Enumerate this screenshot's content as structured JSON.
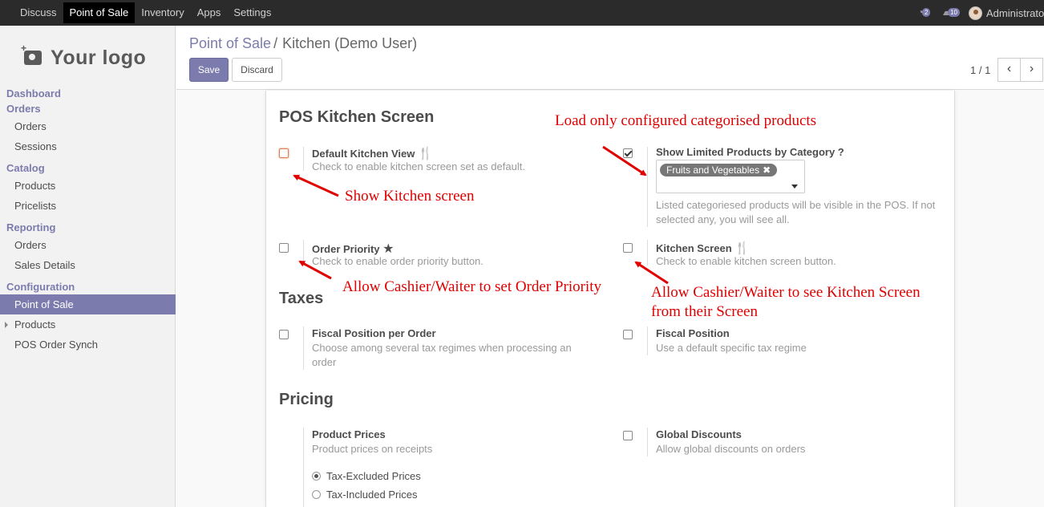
{
  "navbar": {
    "items": [
      "Discuss",
      "Point of Sale",
      "Inventory",
      "Apps",
      "Settings"
    ],
    "active": "Point of Sale",
    "activity_count": "2",
    "message_count": "10",
    "user": "Administrator"
  },
  "sidebar": {
    "logo_text": "Your logo",
    "sections": [
      {
        "label": "Dashboard",
        "items": []
      },
      {
        "label": "Orders",
        "items": [
          "Orders",
          "Sessions"
        ]
      },
      {
        "label": "Catalog",
        "items": [
          "Products",
          "Pricelists"
        ]
      },
      {
        "label": "Reporting",
        "items": [
          "Orders",
          "Sales Details"
        ]
      },
      {
        "label": "Configuration",
        "items": [
          "Point of Sale",
          "Products",
          "POS Order Synch"
        ]
      }
    ],
    "active_item": "Point of Sale"
  },
  "control_panel": {
    "breadcrumb_link": "Point of Sale",
    "breadcrumb_sep": "/",
    "breadcrumb_current": "Kitchen (Demo User)",
    "save_label": "Save",
    "discard_label": "Discard",
    "pager": "1 / 1"
  },
  "form": {
    "section_kitchen": "POS Kitchen Screen",
    "default_kitchen_view": {
      "title": "Default Kitchen View",
      "desc": "Check to enable kitchen screen set as default.",
      "checked": false
    },
    "show_limited": {
      "title": "Show Limited Products by Category ?",
      "tag": "Fruits and Vegetables",
      "desc": "Listed categoriesed products will be visible in the POS. If not selected any, you will see all.",
      "checked": true
    },
    "order_priority": {
      "title": "Order Priority",
      "desc": "Check to enable order priority button.",
      "checked": false
    },
    "kitchen_screen": {
      "title": "Kitchen Screen",
      "desc": "Check to enable kitchen screen button.",
      "checked": false
    },
    "section_taxes": "Taxes",
    "fiscal_per_order": {
      "title": "Fiscal Position per Order",
      "desc": "Choose among several tax regimes when processing an order",
      "checked": false
    },
    "fiscal_position": {
      "title": "Fiscal Position",
      "desc": "Use a default specific tax regime",
      "checked": false
    },
    "section_pricing": "Pricing",
    "product_prices": {
      "title": "Product Prices",
      "desc": "Product prices on receipts",
      "options": [
        "Tax-Excluded Prices",
        "Tax-Included Prices"
      ],
      "selected": "Tax-Excluded Prices"
    },
    "global_discounts": {
      "title": "Global Discounts",
      "desc": "Allow global discounts on orders",
      "checked": false
    }
  },
  "annotations": {
    "load_only": "Load only configured categorised products",
    "show_kitchen": "Show Kitchen screen",
    "allow_priority": "Allow Cashier/Waiter to set Order Priority",
    "allow_kitchen_line1": "Allow Cashier/Waiter to see Kitchen Screen",
    "allow_kitchen_line2": "from their Screen",
    "color": "#e00000"
  },
  "colors": {
    "brand": "#7c7bad",
    "navbar": "#2b2b2b"
  }
}
